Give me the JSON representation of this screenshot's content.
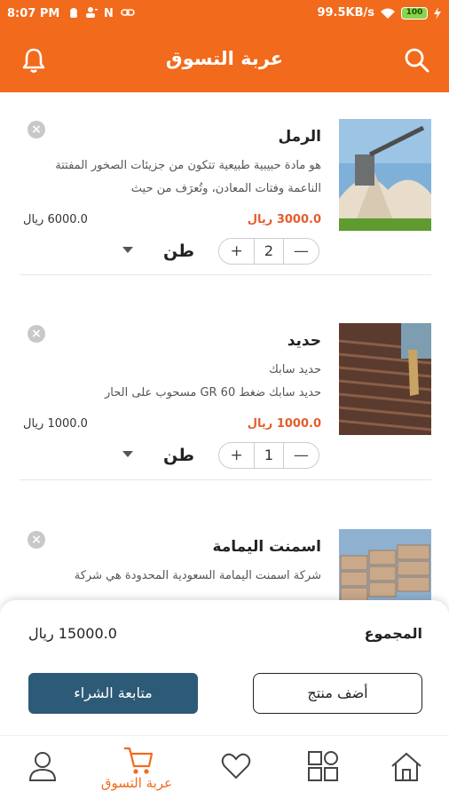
{
  "status": {
    "time": "8:07 PM",
    "speed": "99.5KB/s",
    "battery": "100"
  },
  "header": {
    "title": "عربة التسوق"
  },
  "items": [
    {
      "name": "الرمل",
      "description": "هو مادة حبيبية طبيعية تتكون من جزيئات الصخور المفتتة الناعمة وفتات المعادن، وتُعرَف من حيث",
      "price": "3000.0  ريال",
      "old_price": "6000.0  ريال",
      "quantity": "2",
      "unit": "طن"
    },
    {
      "name": "حديد",
      "description": "حديد سابك\nحديد سابك ضغط GR 60 مسحوب على الحار",
      "price": "1000.0  ريال",
      "old_price": "1000.0  ريال",
      "quantity": "1",
      "unit": "طن"
    },
    {
      "name": "اسمنت اليمامة",
      "description": "شركة اسمنت اليمامة السعودية المحدودة هي شركة"
    }
  ],
  "summary": {
    "total_label": "المجموع",
    "total_value": "15000.0  ريال",
    "add_product": "أضف منتج",
    "checkout": "متابعة الشراء"
  },
  "nav": {
    "cart_label": "عربة التسوق"
  },
  "colors": {
    "primary": "#f26a1b",
    "accent_button": "#2d5a76",
    "price": "#e45d2a"
  }
}
